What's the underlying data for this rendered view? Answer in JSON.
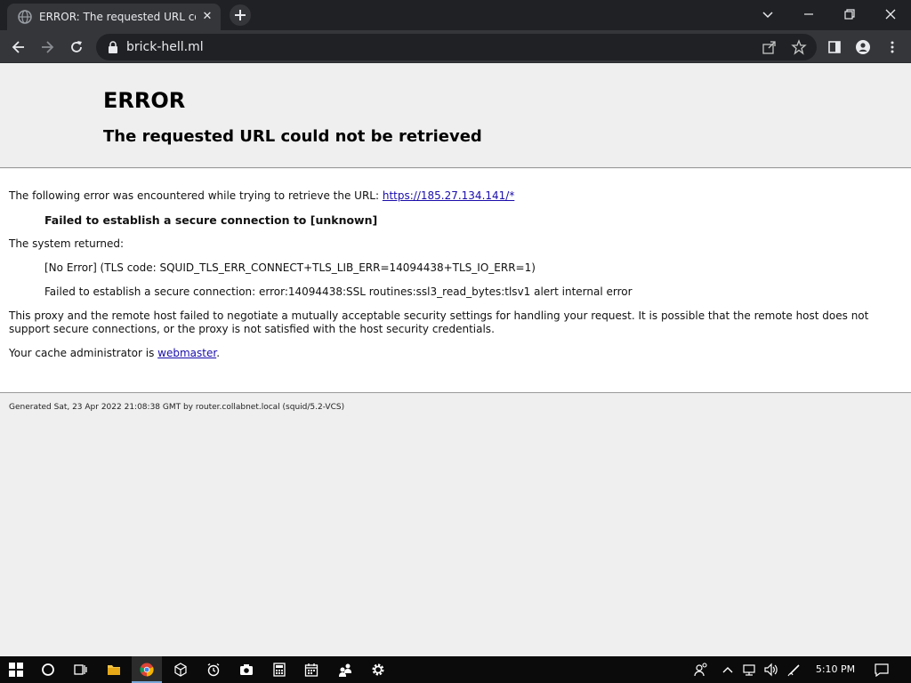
{
  "browser": {
    "tab": {
      "title": "ERROR: The requested URL could not be retrieved",
      "close_glyph": "✕"
    },
    "newtab_icon": "plus-icon",
    "url": "brick-hell.ml",
    "colors": {
      "titlebar": "#202124",
      "toolbar": "#35363a",
      "omnibox": "#202124"
    }
  },
  "page": {
    "heading": "ERROR",
    "subheading": "The requested URL could not be retrieved",
    "intro_text": "The following error was encountered while trying to retrieve the URL: ",
    "intro_link": "https://185.27.134.141/*",
    "error_title": "Failed to establish a secure connection to [unknown]",
    "system_returned": "The system returned:",
    "error_code": "[No Error] (TLS code: SQUID_TLS_ERR_CONNECT+TLS_LIB_ERR=14094438+TLS_IO_ERR=1)",
    "error_detail": "Failed to establish a secure connection: error:14094438:SSL routines:ssl3_read_bytes:tlsv1 alert internal error",
    "explanation": "This proxy and the remote host failed to negotiate a mutually acceptable security settings for handling your request. It is possible that the remote host does not support secure connections, or the proxy is not satisfied with the host security credentials.",
    "admin_text": "Your cache administrator is ",
    "admin_link": "webmaster",
    "admin_suffix": ".",
    "footer": "Generated Sat, 23 Apr 2022 21:08:38 GMT by router.collabnet.local (squid/5.2-VCS)",
    "link_color": "#1a0dab"
  },
  "taskbar": {
    "clock": "5:10 PM",
    "icons": [
      "windows-start-icon",
      "cortana-icon",
      "task-view-icon",
      "file-explorer-icon",
      "chrome-icon",
      "3d-viewer-icon",
      "alarms-icon",
      "camera-icon",
      "calculator-icon",
      "calendar-icon",
      "people-icon",
      "settings-icon"
    ],
    "tray_icons": [
      "people-tray-icon",
      "chevron-up-icon",
      "network-icon",
      "volume-icon",
      "pen-icon",
      "notification-icon"
    ]
  }
}
